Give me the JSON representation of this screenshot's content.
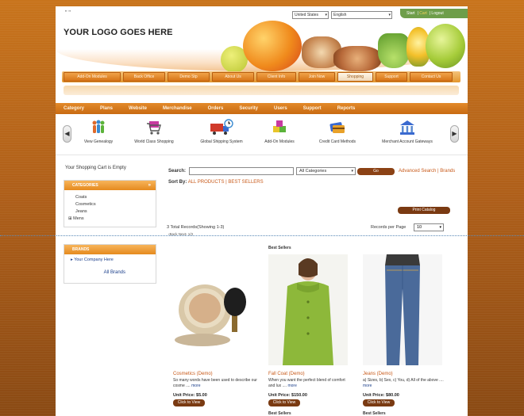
{
  "header": {
    "quote_mark": "\" \"",
    "logo_text": "YOUR LOGO GOES HERE",
    "country_select": "United States",
    "language_select": "English",
    "user_links": [
      "Start",
      "Cart",
      "Logout"
    ]
  },
  "main_nav": [
    "Add-On Modules",
    "Back Office",
    "Demo Stp",
    "About Us",
    "Client Info",
    "Join Now",
    "Shopping",
    "Support",
    "Contact Us"
  ],
  "main_nav_active": "Shopping",
  "category_bar": [
    "Category",
    "Plans",
    "Website",
    "Merchandise",
    "Orders",
    "Security",
    "Users",
    "Support",
    "Reports"
  ],
  "icon_strip": [
    {
      "label": "View Genealogy",
      "icon": "people-icon"
    },
    {
      "label": "World Class Shopping",
      "icon": "shopping-cart-icon"
    },
    {
      "label": "Global Shipping System",
      "icon": "truck-clock-icon"
    },
    {
      "label": "Add-On Modules",
      "icon": "puzzle-icon"
    },
    {
      "label": "Credit Card Methods",
      "icon": "credit-card-icon"
    },
    {
      "label": "Merchant Account Gateways",
      "icon": "bank-icon"
    }
  ],
  "cart_status": "Your Shopping Cart is Empty",
  "categories_box": {
    "title": "CATEGORIES",
    "items": [
      "Coats",
      "Cosmetics",
      "Jeans",
      "Mens"
    ]
  },
  "brands_box": {
    "title": "BRANDS",
    "items": [
      "Your Company Here"
    ],
    "all_link": "All Brands"
  },
  "search": {
    "label": "Search:",
    "value": "",
    "category": "All Categories",
    "go_label": "Go",
    "advanced_link": "Advanced Search | Brands"
  },
  "sort": {
    "label": "Sort By:",
    "links": "ALL PRODUCTS | BEST SELLERS"
  },
  "print_catalog": "Print Catalog",
  "records": {
    "summary": "3 Total Records(Showing 1-3)",
    "pager": "‹Back Next› 1/3",
    "per_page_label": "Records per Page",
    "per_page_value": "10"
  },
  "products": [
    {
      "badge": "",
      "name": "Cosmetics (Demo)",
      "desc": "So many words have been used to describe our cosme ....",
      "more": "more",
      "price": "Unit Price: $5.00",
      "button": "Click to View"
    },
    {
      "badge": "Best Sellers",
      "name": "Fall Coat (Demo)",
      "desc": "When you want the perfect blend of comfort and lux ....",
      "more": "more",
      "price": "Unit Price: $150.00",
      "button": "Click to View"
    },
    {
      "badge": "",
      "name": "Jeans (Demo)",
      "desc": "a) Sizes, b) Sex, c) You, d) All of the above ....",
      "more": "more",
      "price": "Unit Price: $80.00",
      "button": "Click to View"
    }
  ],
  "bottom_badges": [
    "Best Sellers",
    "Best Sellers"
  ],
  "colors": {
    "nav_orange": "#e38a2a",
    "brown_button": "#7a3a12",
    "link_orange": "#c85a1a",
    "coat_green": "#8db83a"
  }
}
